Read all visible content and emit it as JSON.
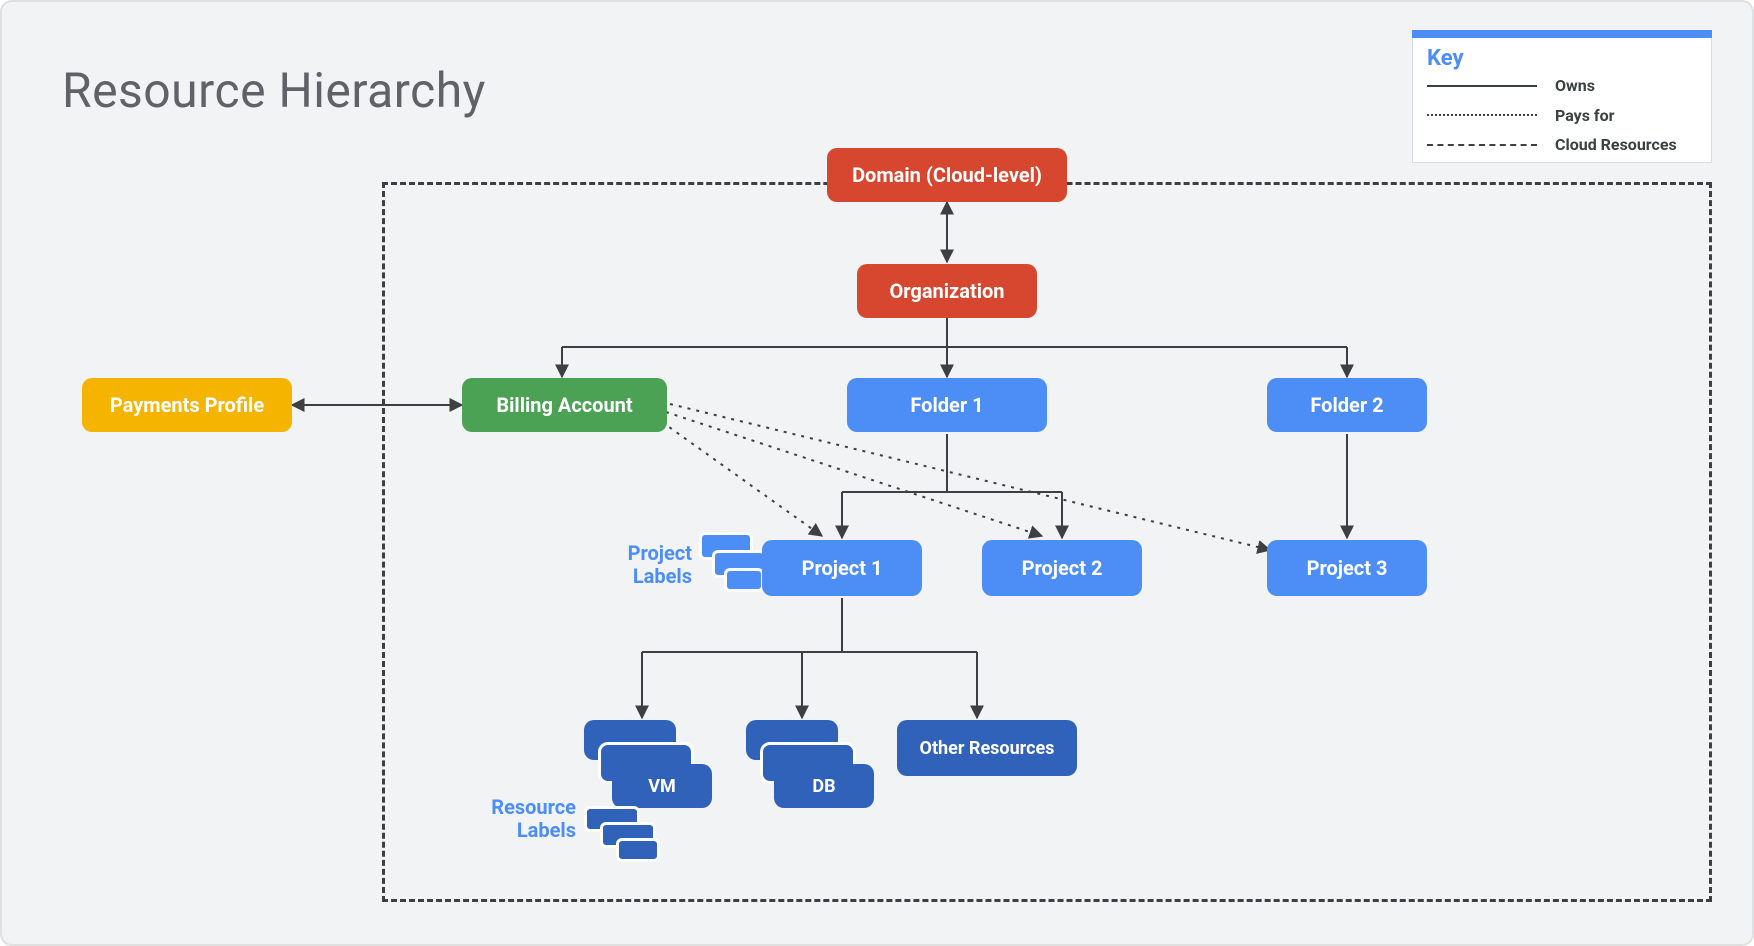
{
  "title": "Resource Hierarchy",
  "legend": {
    "title": "Key",
    "owns": "Owns",
    "pays_for": "Pays for",
    "cloud_resources": "Cloud Resources"
  },
  "nodes": {
    "domain": "Domain (Cloud-level)",
    "organization": "Organization",
    "payments_profile": "Payments Profile",
    "billing_account": "Billing Account",
    "folder1": "Folder 1",
    "folder2": "Folder 2",
    "project1": "Project 1",
    "project2": "Project 2",
    "project3": "Project 3",
    "vm": "VM",
    "db": "DB",
    "other_resources": "Other Resources"
  },
  "labels": {
    "project_labels": "Project Labels",
    "resource_labels": "Resource Labels"
  }
}
